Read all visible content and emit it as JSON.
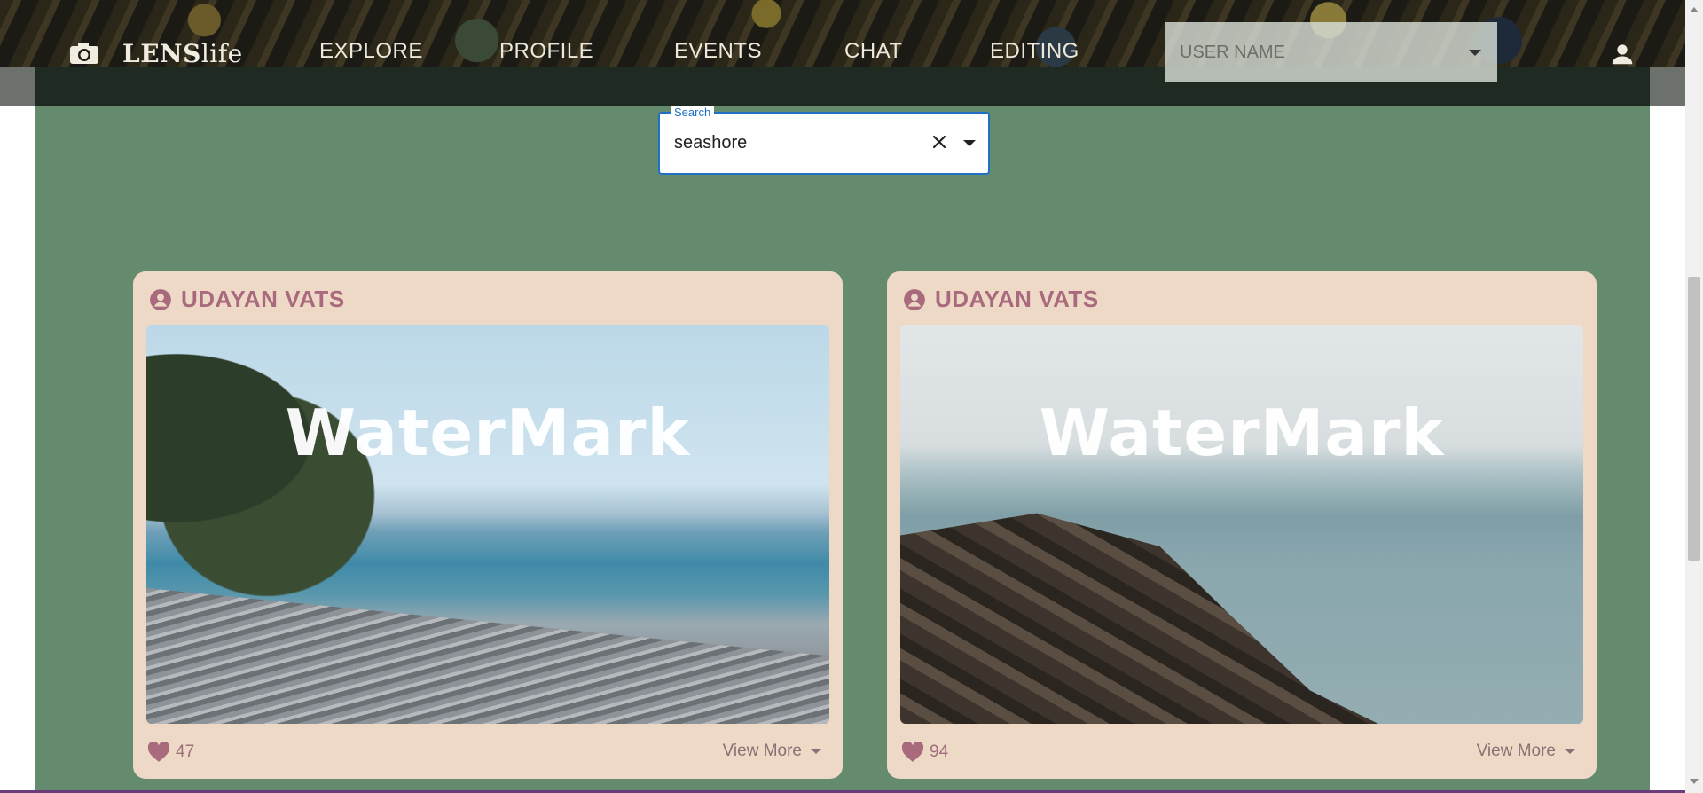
{
  "header": {
    "logo_bold": "LENS",
    "logo_light": "life",
    "nav": [
      "EXPLORE",
      "PROFILE",
      "EVENTS",
      "CHAT",
      "EDITING"
    ],
    "user_select_value": "USER NAME",
    "icons": [
      "camera-icon",
      "account-icon",
      "chevron-down-icon"
    ]
  },
  "search": {
    "label": "Search",
    "value": "seashore"
  },
  "cards": [
    {
      "author": "UDAYAN VATS",
      "watermark": "WaterMark",
      "likes": "47",
      "view_more": "View More"
    },
    {
      "author": "UDAYAN VATS",
      "watermark": "WaterMark",
      "likes": "94",
      "view_more": "View More"
    }
  ],
  "colors": {
    "main_bg": "#648b6e",
    "card_bg": "#eed9c6",
    "accent": "#a96a7e",
    "search_border": "#1f6fc4",
    "dark_bar": "#1f2a22"
  }
}
